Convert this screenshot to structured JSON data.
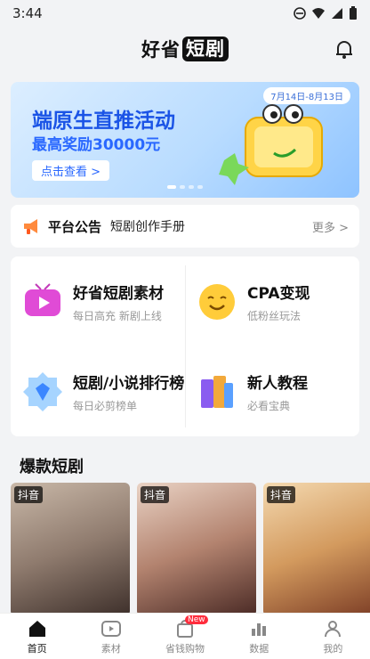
{
  "status": {
    "time": "3:44"
  },
  "header": {
    "title_prefix": "好省",
    "title_tag": "短剧"
  },
  "banner": {
    "date_range": "7月14日-8月13日",
    "title": "端原生直推活动",
    "subtitle": "最高奖励30000元",
    "cta": "点击查看 >"
  },
  "notice": {
    "label": "平台公告",
    "text": "短剧创作手册",
    "more": "更多 >"
  },
  "features": [
    {
      "title": "好省短剧素材",
      "desc": "每日高充 新剧上线"
    },
    {
      "title": "CPA变现",
      "desc": "低粉丝玩法"
    },
    {
      "title": "短剧/小说排行榜",
      "desc": "每日必剪榜单"
    },
    {
      "title": "新人教程",
      "desc": "必看宝典"
    }
  ],
  "section": {
    "title": "爆款短剧"
  },
  "posters": [
    {
      "platform": "抖音"
    },
    {
      "platform": "抖音"
    },
    {
      "platform": "抖音"
    }
  ],
  "tabs": [
    {
      "label": "首页"
    },
    {
      "label": "素材"
    },
    {
      "label": "省钱购物",
      "badge": "New"
    },
    {
      "label": "数据"
    },
    {
      "label": "我的"
    }
  ],
  "colors": {
    "accent": "#2a68ff",
    "badge": "#ff2d3d"
  }
}
